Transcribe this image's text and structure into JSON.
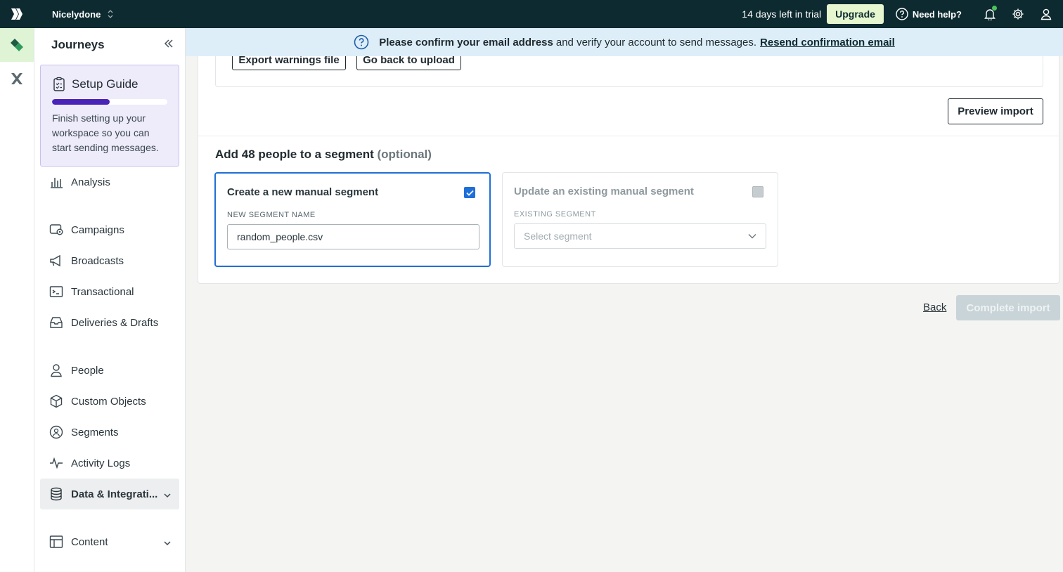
{
  "topbar": {
    "workspace": "Nicelydone",
    "trial_text": "14 days left in trial",
    "upgrade_label": "Upgrade",
    "help_label": "Need help?"
  },
  "sidebar": {
    "title": "Journeys",
    "setup_guide": {
      "title": "Setup Guide",
      "progress": 0.5,
      "text": "Finish setting up your workspace so you can start sending messages."
    },
    "items": [
      {
        "label": "Analysis",
        "icon": "bar-chart-icon"
      },
      {
        "label": "Campaigns",
        "icon": "campaign-icon"
      },
      {
        "label": "Broadcasts",
        "icon": "megaphone-icon"
      },
      {
        "label": "Transactional",
        "icon": "terminal-icon"
      },
      {
        "label": "Deliveries & Drafts",
        "icon": "inbox-icon"
      },
      {
        "label": "People",
        "icon": "person-icon"
      },
      {
        "label": "Custom Objects",
        "icon": "cube-icon"
      },
      {
        "label": "Segments",
        "icon": "segment-icon"
      },
      {
        "label": "Activity Logs",
        "icon": "pulse-icon"
      },
      {
        "label": "Data & Integrati...",
        "icon": "database-icon",
        "active": true
      },
      {
        "label": "Content",
        "icon": "layout-icon"
      }
    ]
  },
  "banner": {
    "bold_text": "Please confirm your email address",
    "text": "and verify your account to send messages.",
    "link": "Resend confirmation email"
  },
  "main": {
    "export_warnings_label": "Export warnings file",
    "go_back_label": "Go back to upload",
    "preview_import_label": "Preview import",
    "segment_title": "Add 48 people to a segment",
    "segment_optional": "(optional)",
    "new_segment": {
      "title": "Create a new manual segment",
      "checked": true,
      "field_label": "NEW SEGMENT NAME",
      "value": "random_people.csv"
    },
    "existing_segment": {
      "title": "Update an existing manual segment",
      "checked": false,
      "field_label": "EXISTING SEGMENT",
      "placeholder": "Select segment"
    },
    "back_label": "Back",
    "complete_label": "Complete import"
  },
  "colors": {
    "topbar": "#0d2a30",
    "accent_blue": "#1f6fd8",
    "banner": "#ddeef9",
    "setup_purple": "#4a24b8"
  }
}
